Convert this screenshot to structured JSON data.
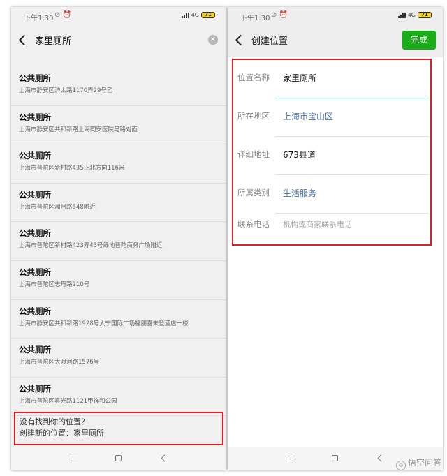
{
  "status_bar": {
    "time": "下午1:30",
    "network": "4G",
    "battery": "71"
  },
  "left": {
    "title": "家里厕所",
    "results": [
      {
        "name": "公共厕所",
        "address": "上海市静安区沪太路1170弄29号乙"
      },
      {
        "name": "公共厕所",
        "address": "上海市静安区共和新路上海同安医院马路对面"
      },
      {
        "name": "公共厕所",
        "address": "上海市普陀区新村路435正北方向116米"
      },
      {
        "name": "公共厕所",
        "address": "上海市普陀区潮州路548附近"
      },
      {
        "name": "公共厕所",
        "address": "上海市普陀区新村路423弄43号绿地普陀商务广场附近"
      },
      {
        "name": "公共厕所",
        "address": "上海市普陀区志丹路210号"
      },
      {
        "name": "公共厕所",
        "address": "上海市静安区共和新路1928号大宁国际广场福朋喜来登酒店一楼"
      },
      {
        "name": "公共厕所",
        "address": "上海市普陀区大渡河路1576号"
      },
      {
        "name": "公共厕所",
        "address": "上海市普陀区真光路1121甲祥和公园"
      }
    ],
    "create": {
      "line1": "没有找到你的位置？",
      "line2": "创建新的位置：家里厕所"
    }
  },
  "right": {
    "title": "创建位置",
    "done_label": "完成",
    "form": {
      "name_label": "位置名称",
      "name_value": "家里厕所",
      "region_label": "所在地区",
      "region_value": "上海市宝山区",
      "address_label": "详细地址",
      "address_value": "673县道",
      "category_label": "所属类别",
      "category_value": "生活服务",
      "phone_label": "联系电话",
      "phone_placeholder": "机构或商家联系电话"
    }
  },
  "watermark": "悟空问答",
  "colors": {
    "accent_green": "#1aad19",
    "highlight_red": "#e01e25",
    "link_blue": "#4a6fa5",
    "input_teal": "#3dbfb0"
  }
}
